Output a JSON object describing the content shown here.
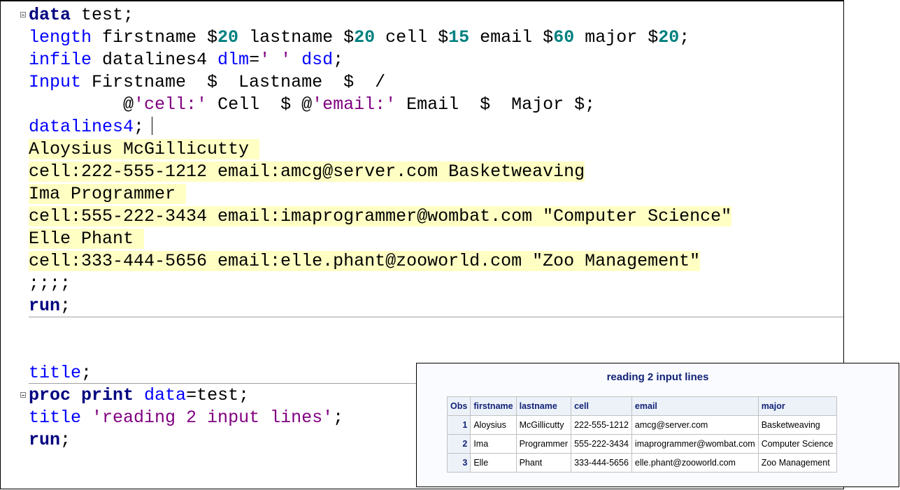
{
  "editor": {
    "lines": [
      {
        "kind": "code",
        "fold": true,
        "tokens": [
          {
            "t": "data",
            "c": "kw"
          },
          {
            "t": " test;",
            "c": ""
          }
        ]
      },
      {
        "kind": "code",
        "tokens": [
          {
            "t": "length",
            "c": "bl"
          },
          {
            "t": " firstname $",
            "c": ""
          },
          {
            "t": "20",
            "c": "num"
          },
          {
            "t": " lastname $",
            "c": ""
          },
          {
            "t": "20",
            "c": "num"
          },
          {
            "t": " cell $",
            "c": ""
          },
          {
            "t": "15",
            "c": "num"
          },
          {
            "t": " email $",
            "c": ""
          },
          {
            "t": "60",
            "c": "num"
          },
          {
            "t": " major $",
            "c": ""
          },
          {
            "t": "20",
            "c": "num"
          },
          {
            "t": ";",
            "c": ""
          }
        ]
      },
      {
        "kind": "code",
        "tokens": [
          {
            "t": "infile",
            "c": "bl"
          },
          {
            "t": " datalines4 ",
            "c": ""
          },
          {
            "t": "dlm",
            "c": "bl"
          },
          {
            "t": "=",
            "c": ""
          },
          {
            "t": "' '",
            "c": "str"
          },
          {
            "t": " ",
            "c": ""
          },
          {
            "t": "dsd",
            "c": "bl"
          },
          {
            "t": ";",
            "c": ""
          }
        ]
      },
      {
        "kind": "code",
        "tokens": [
          {
            "t": "Input",
            "c": "bl"
          },
          {
            "t": " Firstname  $  Lastname  $  /",
            "c": ""
          }
        ]
      },
      {
        "kind": "code",
        "tokens": [
          {
            "t": "         @",
            "c": ""
          },
          {
            "t": "'cell:'",
            "c": "str"
          },
          {
            "t": " Cell  $ @",
            "c": ""
          },
          {
            "t": "'email:'",
            "c": "str"
          },
          {
            "t": " Email  $  Major $;",
            "c": ""
          }
        ]
      },
      {
        "kind": "code",
        "tokens": [
          {
            "t": "datalines4",
            "c": "bl"
          },
          {
            "t": ";",
            "c": ""
          }
        ]
      },
      {
        "kind": "data",
        "text": "Aloysius McGillicutty "
      },
      {
        "kind": "data",
        "text": "cell:222-555-1212 email:amcg@server.com Basketweaving"
      },
      {
        "kind": "data",
        "text": "Ima Programmer "
      },
      {
        "kind": "data",
        "text": "cell:555-222-3434 email:imaprogrammer@wombat.com \"Computer Science\""
      },
      {
        "kind": "data",
        "text": "Elle Phant "
      },
      {
        "kind": "data",
        "text": "cell:333-444-5656 email:elle.phant@zooworld.com \"Zoo Management\""
      },
      {
        "kind": "code",
        "tokens": [
          {
            "t": ";;;;",
            "c": ""
          }
        ]
      },
      {
        "kind": "code",
        "tokens": [
          {
            "t": "run",
            "c": "kw"
          },
          {
            "t": ";",
            "c": ""
          }
        ]
      },
      {
        "kind": "blank"
      },
      {
        "kind": "blank"
      },
      {
        "kind": "code",
        "tokens": [
          {
            "t": "title",
            "c": "bl"
          },
          {
            "t": ";",
            "c": ""
          }
        ]
      },
      {
        "kind": "code",
        "fold": true,
        "tokens": [
          {
            "t": "proc print",
            "c": "kw"
          },
          {
            "t": " ",
            "c": ""
          },
          {
            "t": "data",
            "c": "bl"
          },
          {
            "t": "=test;",
            "c": ""
          }
        ]
      },
      {
        "kind": "code",
        "tokens": [
          {
            "t": "title",
            "c": "bl"
          },
          {
            "t": " ",
            "c": ""
          },
          {
            "t": "'reading 2 input lines'",
            "c": "str"
          },
          {
            "t": ";",
            "c": ""
          }
        ]
      },
      {
        "kind": "code",
        "tokens": [
          {
            "t": "run",
            "c": "kw"
          },
          {
            "t": ";",
            "c": ""
          }
        ]
      }
    ]
  },
  "output": {
    "title": "reading 2 input lines",
    "columns": [
      "Obs",
      "firstname",
      "lastname",
      "cell",
      "email",
      "major"
    ],
    "rows": [
      [
        "1",
        "Aloysius",
        "McGillicutty",
        "222-555-1212",
        "amcg@server.com",
        "Basketweaving"
      ],
      [
        "2",
        "Ima",
        "Programmer",
        "555-222-3434",
        "imaprogrammer@wombat.com",
        "Computer Science"
      ],
      [
        "3",
        "Elle",
        "Phant",
        "333-444-5656",
        "elle.phant@zooworld.com",
        "Zoo Management"
      ]
    ]
  }
}
